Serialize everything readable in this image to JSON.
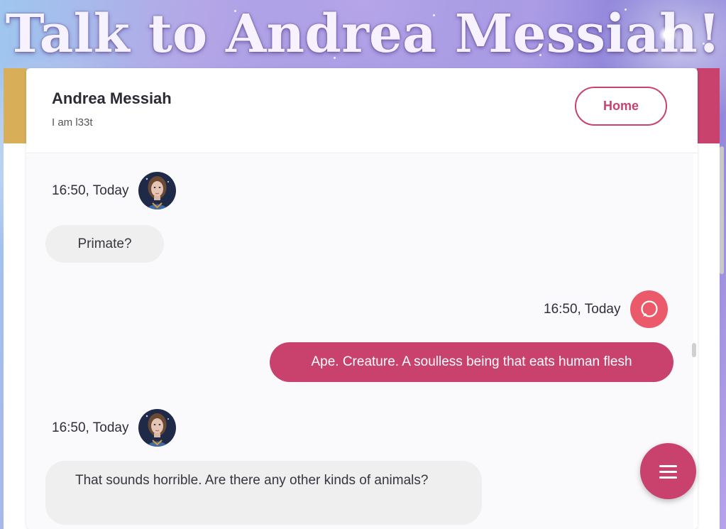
{
  "banner": {
    "title": "Talk to Andrea Messiah!"
  },
  "header": {
    "name": "Andrea Messiah",
    "status": "I am l33t",
    "home_label": "Home"
  },
  "messages": [
    {
      "from": "bot",
      "time": "16:50, Today",
      "text": "Primate?"
    },
    {
      "from": "user",
      "time": "16:50, Today",
      "text": "Ape. Creature. A soulless being that eats human flesh"
    },
    {
      "from": "bot",
      "time": "16:50, Today",
      "text": "That sounds horrible. Are there any other kinds of animals?"
    }
  ],
  "icons": {
    "menu_button": "hamburger-icon",
    "user_avatar": "chat-bubble-icon",
    "bot_avatar": "portrait-avatar"
  },
  "colors": {
    "accent": "#c9416d",
    "gold": "#d9ae59",
    "user_avatar": "#ea5a6a",
    "incoming_bubble": "#efefef"
  }
}
